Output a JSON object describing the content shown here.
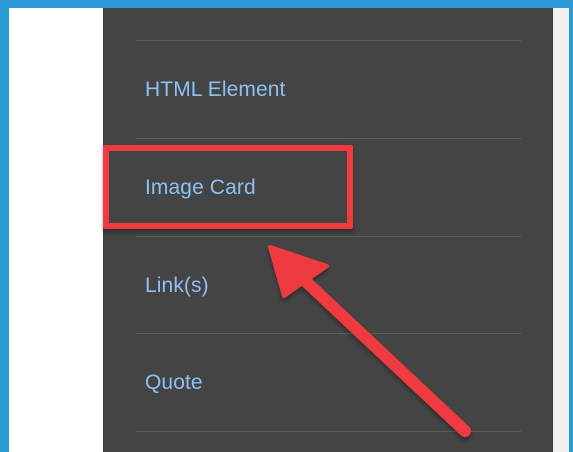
{
  "menu": {
    "items": [
      {
        "label": "HTML Element"
      },
      {
        "label": "Image Card"
      },
      {
        "label": "Link(s)"
      },
      {
        "label": "Quote"
      }
    ]
  },
  "annotation": {
    "highlighted_item": "Image Card",
    "highlight_color": "#ef3b3f",
    "arrow_color": "#ef3b3f"
  },
  "colors": {
    "frame": "#2a9ad6",
    "panel_background": "#444444",
    "link_text": "#8ec0f3"
  }
}
